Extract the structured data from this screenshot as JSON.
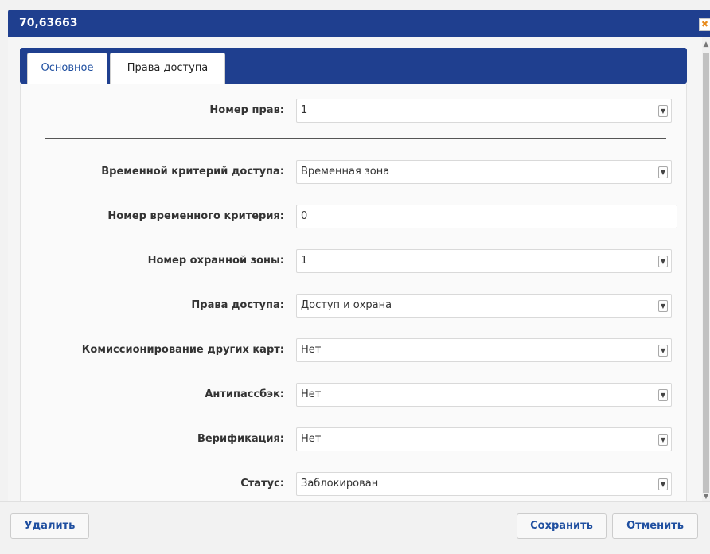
{
  "window": {
    "title": "70,63663",
    "close_glyph": "✖"
  },
  "tabs": [
    {
      "label": "Основное",
      "active": false
    },
    {
      "label": "Права доступа",
      "active": true
    }
  ],
  "form": {
    "fields": [
      {
        "label": "Номер прав:",
        "value": "1",
        "type": "select"
      },
      {
        "label": "Временной критерий доступа:",
        "value": "Временная зона",
        "type": "select"
      },
      {
        "label": "Номер временного критерия:",
        "value": "0",
        "type": "input"
      },
      {
        "label": "Номер охранной зоны:",
        "value": "1",
        "type": "select"
      },
      {
        "label": "Права доступа:",
        "value": "Доступ и охрана",
        "type": "select"
      },
      {
        "label": "Комиссионирование других карт:",
        "value": "Нет",
        "type": "select"
      },
      {
        "label": "Антипассбэк:",
        "value": "Нет",
        "type": "select"
      },
      {
        "label": "Верификация:",
        "value": "Нет",
        "type": "select"
      },
      {
        "label": "Статус:",
        "value": "Заблокирован",
        "type": "select"
      }
    ]
  },
  "buttons": {
    "delete": "Удалить",
    "save": "Сохранить",
    "cancel": "Отменить"
  },
  "icons": {
    "dropdown": "chevron-down-icon",
    "close": "close-icon"
  },
  "colors": {
    "header": "#1f3f8f",
    "link": "#1f4fa0",
    "close_accent": "#e88a1a"
  }
}
